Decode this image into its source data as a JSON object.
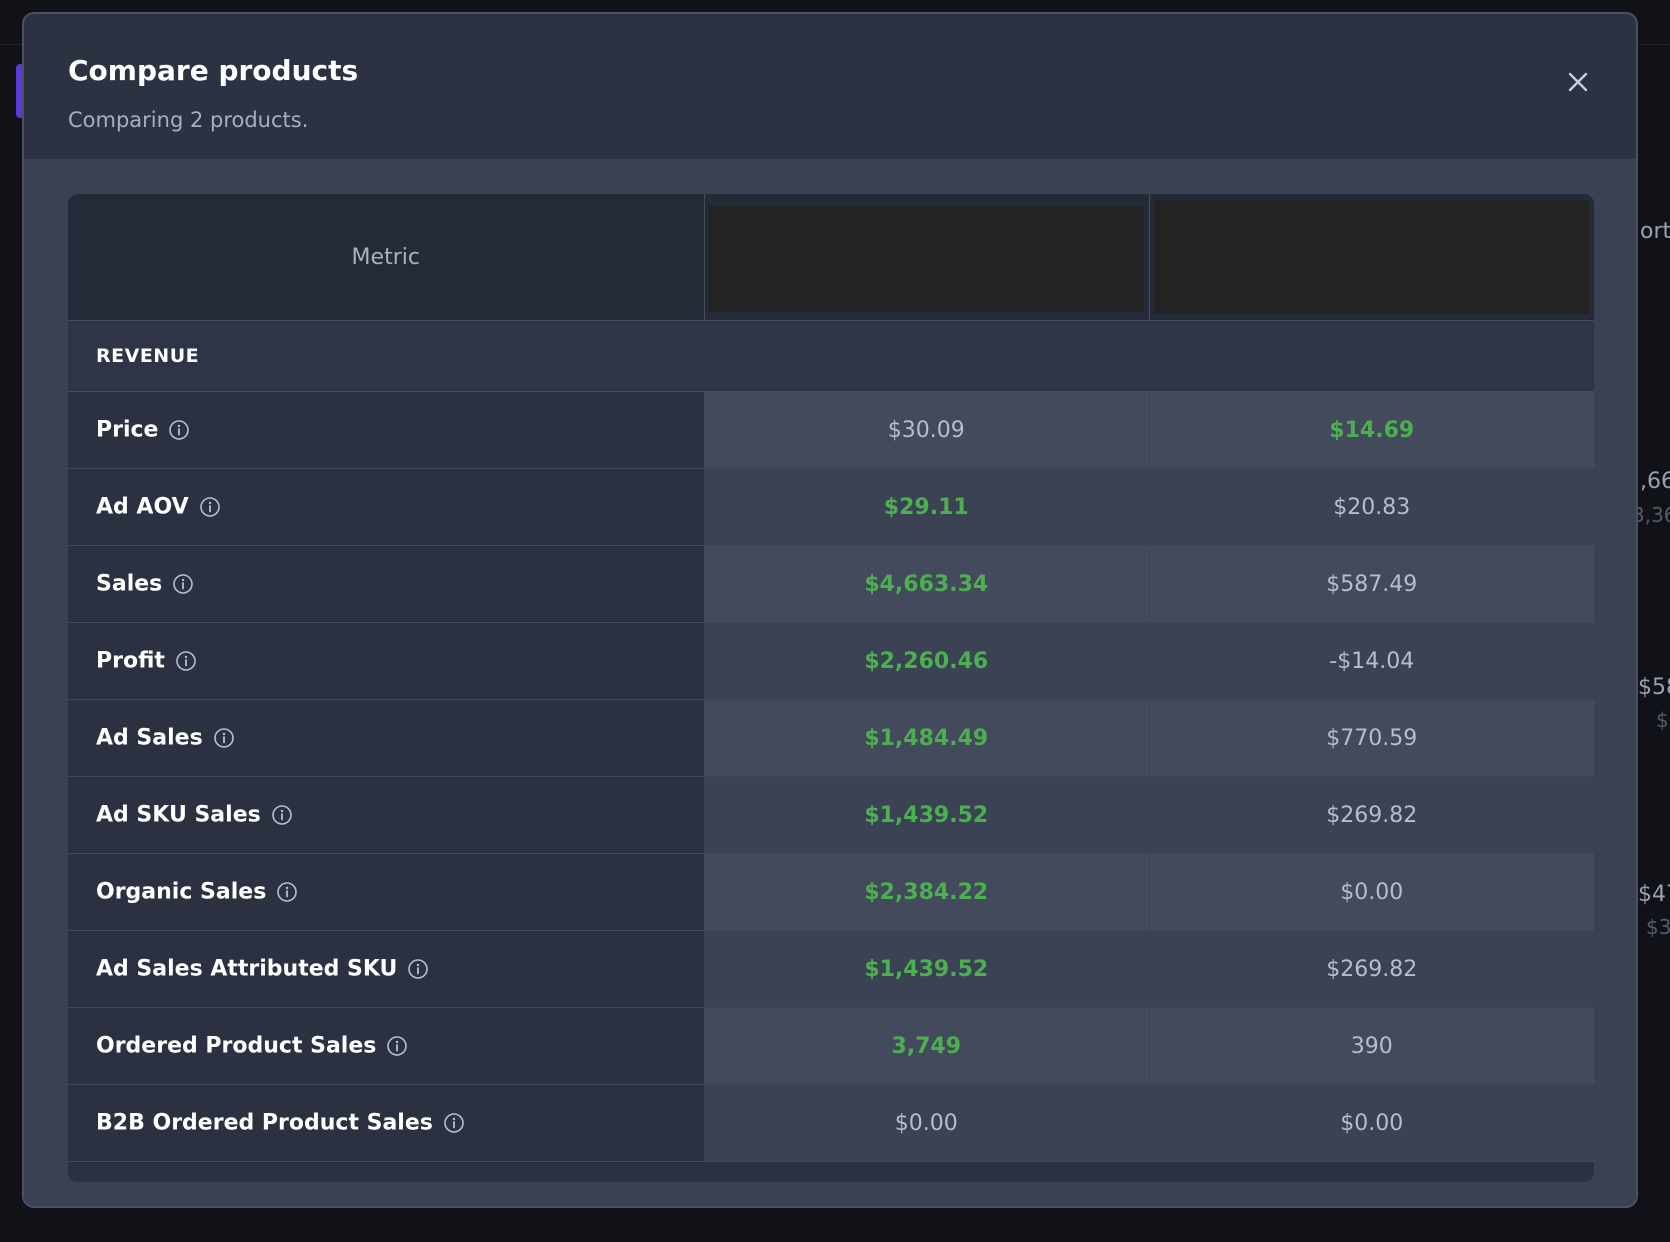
{
  "modal": {
    "title": "Compare products",
    "subtitle": "Comparing 2 products."
  },
  "table": {
    "metric_header": "Metric",
    "section": "REVENUE",
    "rows": [
      {
        "label": "Price",
        "p1": "$30.09",
        "p2": "$14.69",
        "best": "p2"
      },
      {
        "label": "Ad AOV",
        "p1": "$29.11",
        "p2": "$20.83",
        "best": "p1"
      },
      {
        "label": "Sales",
        "p1": "$4,663.34",
        "p2": "$587.49",
        "best": "p1"
      },
      {
        "label": "Profit",
        "p1": "$2,260.46",
        "p2": "-$14.04",
        "best": "p1"
      },
      {
        "label": "Ad Sales",
        "p1": "$1,484.49",
        "p2": "$770.59",
        "best": "p1"
      },
      {
        "label": "Ad SKU Sales",
        "p1": "$1,439.52",
        "p2": "$269.82",
        "best": "p1"
      },
      {
        "label": "Organic Sales",
        "p1": "$2,384.22",
        "p2": "$0.00",
        "best": "p1"
      },
      {
        "label": "Ad Sales Attributed SKU",
        "p1": "$1,439.52",
        "p2": "$269.82",
        "best": "p1"
      },
      {
        "label": "Ordered Product Sales",
        "p1": "3,749",
        "p2": "390",
        "best": "p1"
      },
      {
        "label": "B2B Ordered Product Sales",
        "p1": "$0.00",
        "p2": "$0.00",
        "best": ""
      }
    ]
  },
  "background": {
    "frag_1": "ort",
    "frag_2": ",66",
    "frag_3": "3,36",
    "frag_4": "$58",
    "frag_5": "$",
    "frag_6": "$47",
    "frag_7": "$3"
  },
  "colors": {
    "best": "#4caf50",
    "modal_bg": "#3a4152",
    "header_bg": "#2c3242",
    "accent": "#5b3bd6"
  },
  "icons": {
    "close": "close-icon",
    "info": "info-icon"
  }
}
